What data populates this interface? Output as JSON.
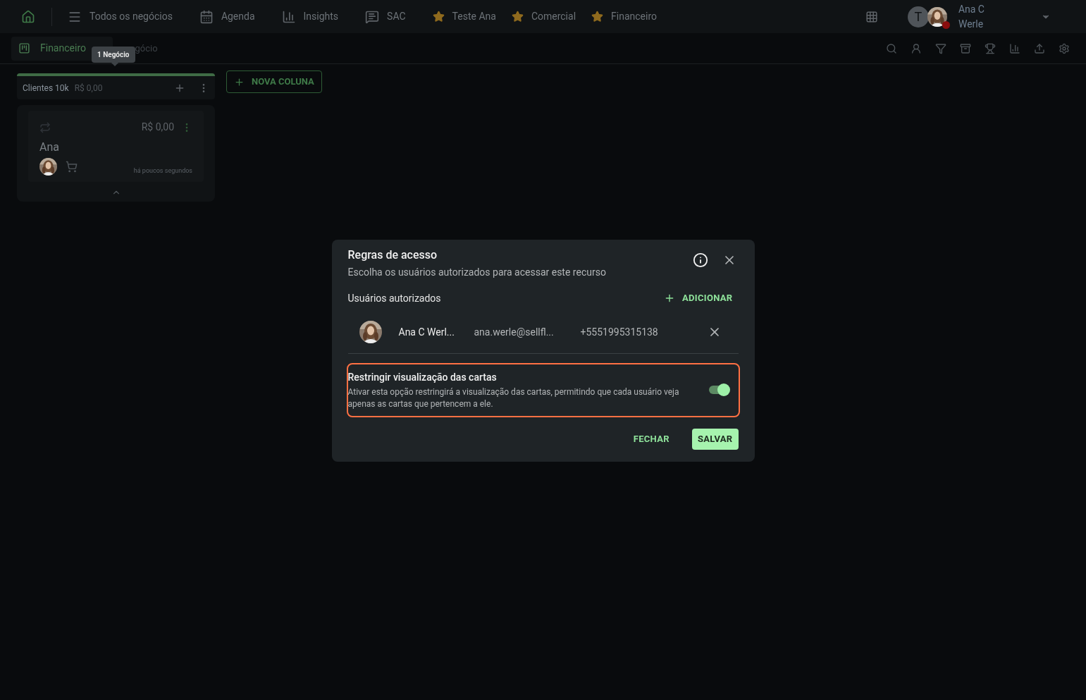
{
  "nav": {
    "items": [
      {
        "kind": "menu",
        "label": "Todos os negócios"
      },
      {
        "kind": "calendar",
        "label": "Agenda"
      },
      {
        "kind": "chart",
        "label": "Insights"
      },
      {
        "kind": "chat",
        "label": "SAC"
      },
      {
        "kind": "star",
        "label": "Teste Ana"
      },
      {
        "kind": "star",
        "label": "Comercial"
      },
      {
        "kind": "star",
        "label": "Financeiro"
      }
    ],
    "user": {
      "initial": "T",
      "name_line1": "Ana C",
      "name_line2": "Werle"
    }
  },
  "board_bar": {
    "tab": {
      "label": "Financeiro",
      "selected": true
    },
    "tooltip": "1 Negócio",
    "subtitle_visible": "gócio"
  },
  "column": {
    "title": "Clientes 10k",
    "total": "R$ 0,00",
    "cards": [
      {
        "value": "R$ 0,00",
        "name": "Ana",
        "time": "há poucos segundos"
      }
    ]
  },
  "new_column_button": "NOVA COLUNA",
  "dialog": {
    "title": "Regras de acesso",
    "subtitle": "Escolha os usuários autorizados para acessar este recurso",
    "section": "Usuários autorizados",
    "add_button": "ADICIONAR",
    "users": [
      {
        "name": "Ana C Werl...",
        "email": "ana.werle@sellfl...",
        "phone": "+5551995315138"
      }
    ],
    "restrict": {
      "title": "Restringir visualização das cartas",
      "description": "Ativar esta opção restringirá a visualização das cartas, permitindo que cada usuário veja apenas as cartas que pertencem a ele.",
      "on": true
    },
    "buttons": {
      "close": "FECHAR",
      "save": "SALVAR"
    }
  }
}
